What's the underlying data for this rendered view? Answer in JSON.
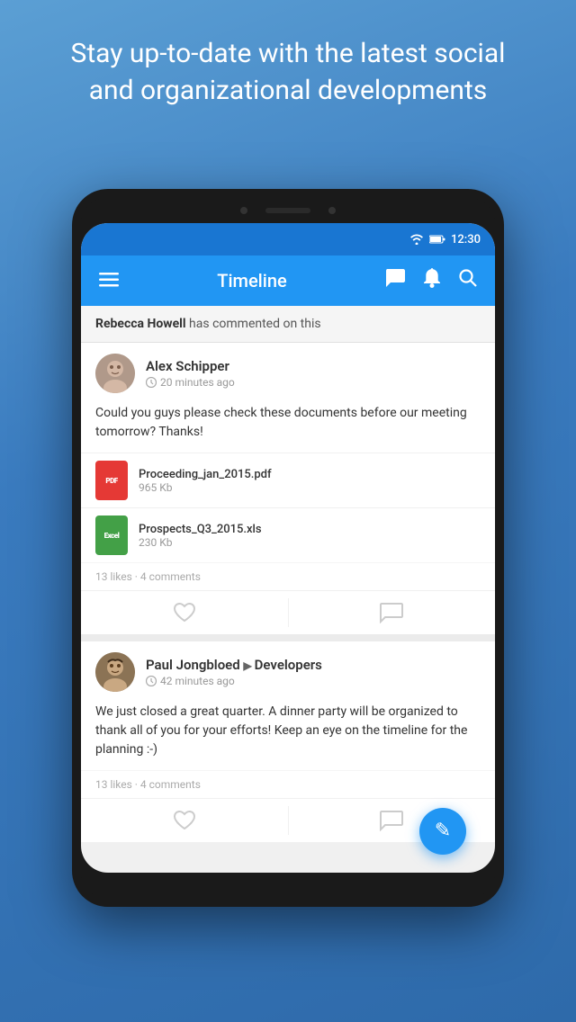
{
  "hero": {
    "text": "Stay up-to-date with the latest social and organizational developments"
  },
  "status_bar": {
    "time": "12:30",
    "wifi_icon": "wifi",
    "battery_icon": "battery"
  },
  "app_bar": {
    "title": "Timeline",
    "menu_icon": "menu",
    "chat_icon": "chat",
    "bell_icon": "bell",
    "search_icon": "search"
  },
  "notification": {
    "name": "Rebecca Howell",
    "message": " has commented on this"
  },
  "post1": {
    "author": "Alex Schipper",
    "time": "20 minutes ago",
    "body": "Could you guys please check these documents before our meeting tomorrow? Thanks!",
    "attachments": [
      {
        "type": "pdf",
        "label": "PDF",
        "name": "Proceeding_jan_2015.pdf",
        "size": "965 Kb"
      },
      {
        "type": "excel",
        "label": "Excel",
        "name": "Prospects_Q3_2015.xls",
        "size": "230 Kb"
      }
    ],
    "stats": "13 likes · 4 comments"
  },
  "post2": {
    "author": "Paul Jongbloed",
    "group": "Developers",
    "time": "42 minutes ago",
    "body": "We just closed a great quarter. A dinner party will be organized to thank all of you for your efforts! Keep an eye on the timeline for the planning :-)",
    "stats": "13 likes · 4 comments"
  },
  "fab": {
    "icon": "✎",
    "label": "compose"
  }
}
